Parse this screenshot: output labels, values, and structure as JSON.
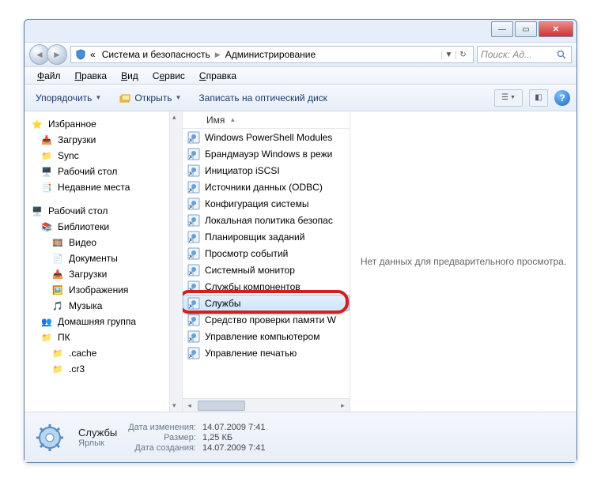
{
  "titlebar": {
    "min": "—",
    "max": "▭",
    "close": "✕"
  },
  "address": {
    "prefix": "«",
    "seg1": "Система и безопасность",
    "seg2": "Администрирование"
  },
  "search": {
    "placeholder": "Поиск: Ад..."
  },
  "menu": {
    "file": "Файл",
    "edit": "Правка",
    "view": "Вид",
    "tools": "Сервис",
    "help": "Справка"
  },
  "toolbar": {
    "organize": "Упорядочить",
    "open": "Открыть",
    "burn": "Записать на оптический диск"
  },
  "sidebar": {
    "fav": "Избранное",
    "downloads": "Загрузки",
    "sync": "Sync",
    "desktop": "Рабочий стол",
    "recent": "Недавние места",
    "desktop_root": "Рабочий стол",
    "libs": "Библиотеки",
    "video": "Видео",
    "docs": "Документы",
    "dl2": "Загрузки",
    "pics": "Изображения",
    "music": "Музыка",
    "homegroup": "Домашняя группа",
    "pc": "ПК",
    "cache": ".cache",
    "cr3": ".cr3"
  },
  "list": {
    "col_name": "Имя",
    "items": [
      "Windows PowerShell Modules",
      "Брандмауэр Windows в режи",
      "Инициатор iSCSI",
      "Источники данных (ODBC)",
      "Конфигурация системы",
      "Локальная политика безопас",
      "Планировщик заданий",
      "Просмотр событий",
      "Системный монитор",
      "Службы компонентов",
      "Службы",
      "Средство проверки памяти W",
      "Управление компьютером",
      "Управление печатью"
    ],
    "selected_index": 10
  },
  "preview": {
    "empty": "Нет данных для предварительного просмотра."
  },
  "details": {
    "name": "Службы",
    "type": "Ярлык",
    "mod_lbl": "Дата изменения:",
    "mod_val": "14.07.2009 7:41",
    "size_lbl": "Размер:",
    "size_val": "1,25 КБ",
    "created_lbl": "Дата создания:",
    "created_val": "14.07.2009 7:41"
  }
}
